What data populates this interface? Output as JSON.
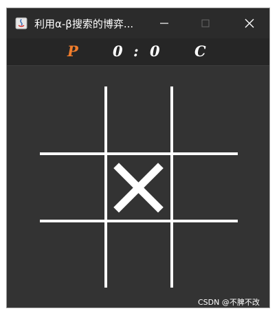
{
  "window": {
    "title": "利用α-β搜索的博弈..."
  },
  "score_bar": {
    "player_label": "P",
    "player_score": "0",
    "separator": ":",
    "computer_score": "0",
    "computer_label": "C"
  },
  "board": {
    "cells": [
      "",
      "",
      "",
      "",
      "X",
      "",
      "",
      "",
      ""
    ]
  },
  "watermark": "CSDN @不脾不改",
  "colors": {
    "player": "#f07d2c",
    "board_bg": "#333333",
    "lines": "#ffffff"
  }
}
